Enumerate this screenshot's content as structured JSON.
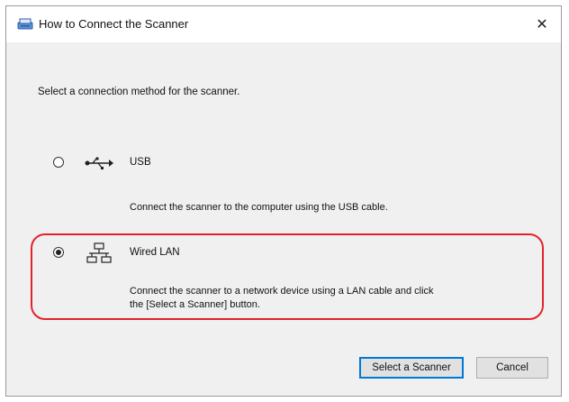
{
  "window": {
    "title": "How to Connect the Scanner",
    "close_label": "✕"
  },
  "instruction": "Select a connection method for the scanner.",
  "options": [
    {
      "label": "USB",
      "description": "Connect the scanner to the computer using the USB cable.",
      "selected": false
    },
    {
      "label": "Wired LAN",
      "description_line1": "Connect the scanner to a network device using a LAN cable and click",
      "description_line2": "the [Select a Scanner] button.",
      "selected": true
    }
  ],
  "buttons": {
    "select_scanner": "Select a Scanner",
    "cancel": "Cancel"
  },
  "colors": {
    "highlight": "#e2232d",
    "default_button_border": "#0078d7"
  }
}
